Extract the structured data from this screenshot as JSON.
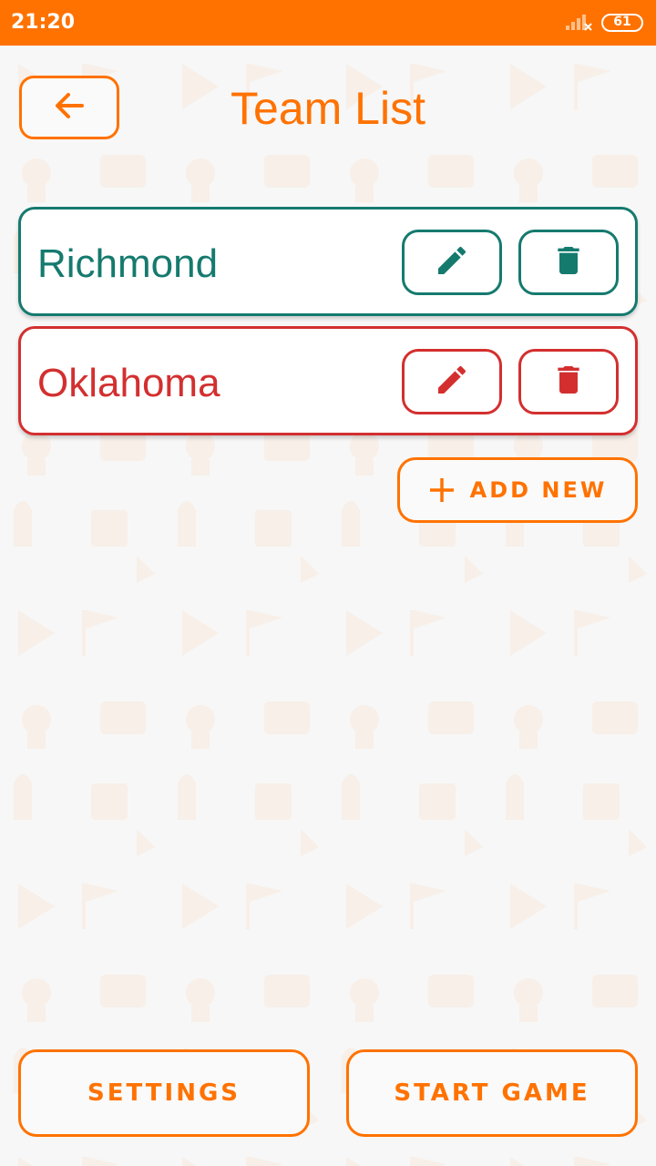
{
  "status_bar": {
    "time": "21:20",
    "battery": "61"
  },
  "header": {
    "title": "Team List"
  },
  "teams": [
    {
      "name": "Richmond",
      "color": "#157a6e"
    },
    {
      "name": "Oklahoma",
      "color": "#d32f2f"
    }
  ],
  "actions": {
    "add_new": "ADD NEW",
    "settings": "SETTINGS",
    "start_game": "START GAME"
  },
  "colors": {
    "accent": "#ff7200",
    "background": "#f7f7f7"
  }
}
